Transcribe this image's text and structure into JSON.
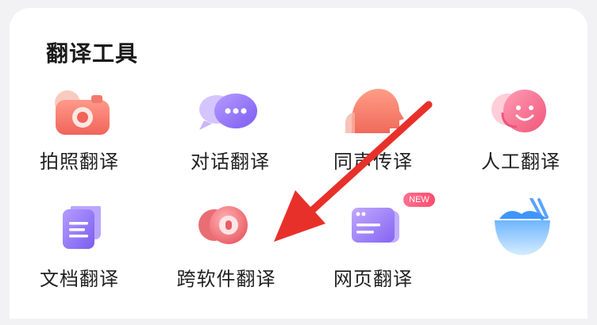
{
  "section": {
    "title": "翻译工具"
  },
  "tools": [
    {
      "label": "拍照翻译",
      "icon": "camera-icon"
    },
    {
      "label": "对话翻译",
      "icon": "chat-bubbles-icon"
    },
    {
      "label": "同声传译",
      "icon": "head-profile-icon"
    },
    {
      "label": "人工翻译",
      "icon": "agent-headset-icon"
    },
    {
      "label": "文档翻译",
      "icon": "document-icon"
    },
    {
      "label": "跨软件翻译",
      "icon": "cross-app-icon"
    },
    {
      "label": "网页翻译",
      "icon": "web-page-icon"
    },
    {
      "label": "",
      "icon": "bowl-icon"
    }
  ],
  "badges": {
    "web_new": "NEW"
  },
  "colors": {
    "arrow": "#e8302a",
    "accent_red": "#f06a6a",
    "accent_purple": "#8b6bff"
  }
}
